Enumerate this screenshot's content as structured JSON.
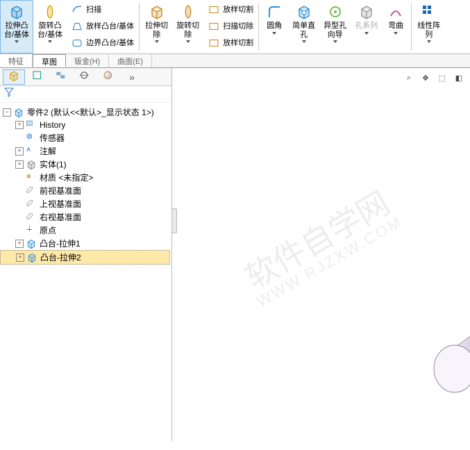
{
  "ribbon": {
    "groups": [
      {
        "items": [
          {
            "kind": "big",
            "label": "拉伸凸\n台/基体",
            "icon": "extrude-boss",
            "active": true,
            "dd": true
          },
          {
            "kind": "big",
            "label": "旋转凸\n台/基体",
            "icon": "revolve-boss",
            "dd": true
          }
        ]
      },
      {
        "items": [
          {
            "kind": "small",
            "label": "扫描",
            "icon": "sweep"
          },
          {
            "kind": "small",
            "label": "放样凸台/基体",
            "icon": "loft-boss"
          },
          {
            "kind": "small",
            "label": "边界凸台/基体",
            "icon": "boundary-boss"
          }
        ]
      },
      {
        "sep": true
      },
      {
        "items": [
          {
            "kind": "big",
            "label": "拉伸切\n除",
            "icon": "extrude-cut",
            "dd": true
          },
          {
            "kind": "big",
            "label": "旋转切\n除",
            "icon": "revolve-cut",
            "dd": true
          }
        ]
      },
      {
        "items": [
          {
            "kind": "small",
            "label": "放样切割",
            "icon": "loft-cut"
          },
          {
            "kind": "small",
            "label": "扫描切除",
            "icon": "sweep-cut"
          },
          {
            "kind": "small",
            "label": "放样切割",
            "icon": "boundary-cut"
          }
        ]
      },
      {
        "sep": true
      },
      {
        "items": [
          {
            "kind": "big",
            "label": "圆角",
            "icon": "fillet",
            "dd": true
          },
          {
            "kind": "big",
            "label": "简单直\n孔",
            "icon": "simple-hole",
            "dd": true
          },
          {
            "kind": "big",
            "label": "异型孔\n向导",
            "icon": "hole-wizard",
            "dd": true
          },
          {
            "kind": "big",
            "label": "孔系列",
            "icon": "hole-series",
            "disabled": true,
            "dd": true
          },
          {
            "kind": "big",
            "label": "弯曲",
            "icon": "flex",
            "dd": true
          }
        ]
      },
      {
        "sep": true
      },
      {
        "items": [
          {
            "kind": "big",
            "label": "线性阵\n列",
            "icon": "linear-pattern",
            "dd": true
          }
        ]
      }
    ]
  },
  "tabs": [
    {
      "key": "feature",
      "label": "特征"
    },
    {
      "key": "sketch",
      "label": "草图"
    },
    {
      "key": "sheetmetal",
      "label": "钣金(H)"
    },
    {
      "key": "surface",
      "label": "曲面(E)"
    }
  ],
  "fm_tabs": [
    {
      "key": "featuremgr",
      "icon": "fm-tree",
      "active": true
    },
    {
      "key": "propertymgr",
      "icon": "fm-prop"
    },
    {
      "key": "configmgr",
      "icon": "fm-conf"
    },
    {
      "key": "dimxpert",
      "icon": "fm-dim"
    },
    {
      "key": "display",
      "icon": "fm-disp"
    },
    {
      "key": "more",
      "icon": "fm-more"
    }
  ],
  "tree": {
    "root": "零件2  (默认<<默认>_显示状态 1>)",
    "children": [
      {
        "label": "History",
        "icon": "history",
        "exp": false
      },
      {
        "label": "传感器",
        "icon": "sensor"
      },
      {
        "label": "注解",
        "icon": "annotation",
        "exp": false
      },
      {
        "label": "实体(1)",
        "icon": "solidbodies",
        "exp": false
      },
      {
        "label": "材质 <未指定>",
        "icon": "material"
      },
      {
        "label": "前视基准面",
        "icon": "plane"
      },
      {
        "label": "上视基准面",
        "icon": "plane"
      },
      {
        "label": "右视基准面",
        "icon": "plane"
      },
      {
        "label": "原点",
        "icon": "origin"
      },
      {
        "label": "凸台-拉伸1",
        "icon": "extrude-feat",
        "exp": false
      },
      {
        "label": "凸台-拉伸2",
        "icon": "extrude-feat",
        "exp": false,
        "selected": true
      }
    ]
  },
  "watermark": {
    "main": "软件自学网",
    "sub": "WWW.RJZXW.COM"
  },
  "view_tools": [
    {
      "name": "zoom-fit-icon",
      "glyph": "⌕"
    },
    {
      "name": "zoom-area-icon",
      "glyph": "✥"
    },
    {
      "name": "view-orient-icon",
      "glyph": "⬚"
    },
    {
      "name": "display-style-icon",
      "glyph": "◧"
    }
  ]
}
